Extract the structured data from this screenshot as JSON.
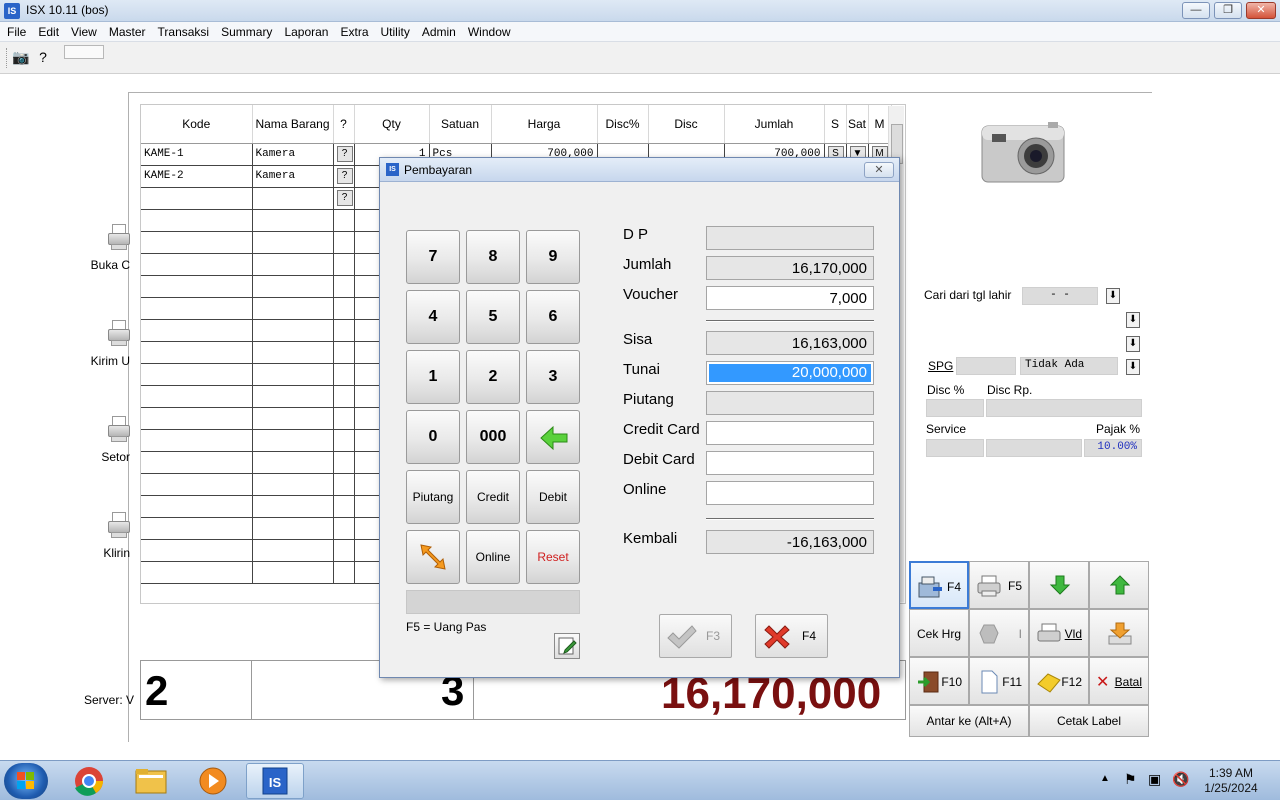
{
  "window": {
    "title": "ISX 10.11 (bos)",
    "icon": "IS"
  },
  "menu": [
    "File",
    "Edit",
    "View",
    "Master",
    "Transaksi",
    "Summary",
    "Laporan",
    "Extra",
    "Utility",
    "Admin",
    "Window"
  ],
  "toolbar": {
    "icons": [
      "camera-icon",
      "help-icon"
    ]
  },
  "side_items": [
    {
      "label": "Buka C",
      "icon": "printer-icon"
    },
    {
      "label": "Kirim U",
      "icon": "printer-icon"
    },
    {
      "label": "Setor",
      "icon": "printer-icon"
    },
    {
      "label": "Klirin",
      "icon": "printer-icon"
    }
  ],
  "grid": {
    "headers": [
      "Kode",
      "Nama Barang",
      "?",
      "Qty",
      "Satuan",
      "Harga",
      "Disc%",
      "Disc",
      "Jumlah",
      "S",
      "Sat",
      "M"
    ],
    "rows": [
      {
        "kode": "KAME-1",
        "nama": "Kamera",
        "q": "?",
        "qty": "1",
        "satuan": "Pcs",
        "harga": "700,000",
        "jumlah": "700,000",
        "s": "S",
        "sat": "▼",
        "m": "M"
      },
      {
        "kode": "KAME-2",
        "nama": "Kamera",
        "q": "?"
      },
      {
        "kode": "",
        "nama": "",
        "q": "?"
      }
    ]
  },
  "summary": {
    "count": "2",
    "qty": "3",
    "total": "16,170,000",
    "server_label": "Server: V"
  },
  "right_panel": {
    "cari_label": "Cari dari tgl lahir",
    "cari_value": "-  -",
    "spg_label": "SPG",
    "spg_value": "Tidak Ada",
    "disc_pct_label": "Disc %",
    "disc_rp_label": "Disc Rp.",
    "service_label": "Service",
    "pajak_label": "Pajak %",
    "pajak_value": "10.00%"
  },
  "function_buttons": {
    "f4": "F4",
    "f5": "F5",
    "cek_hrg": "Cek Hrg",
    "i_label": "I",
    "vld": "Vld",
    "f10": "F10",
    "f11": "F11",
    "f12": "F12",
    "batal": "Batal",
    "antar": "Antar ke (Alt+A)",
    "cetak_label": "Cetak Label"
  },
  "dialog": {
    "title": "Pembayaran",
    "keypad": [
      "7",
      "8",
      "9",
      "4",
      "5",
      "6",
      "1",
      "2",
      "3",
      "0",
      "000"
    ],
    "btn_piutang": "Piutang",
    "btn_credit": "Credit",
    "btn_debit": "Debit",
    "btn_online": "Online",
    "btn_reset": "Reset",
    "hint": "F5 = Uang Pas",
    "fields": {
      "dp": {
        "label": "D P",
        "value": ""
      },
      "jumlah": {
        "label": "Jumlah",
        "value": "16,170,000"
      },
      "voucher": {
        "label": "Voucher",
        "value": "7,000"
      },
      "sisa": {
        "label": "Sisa",
        "value": "16,163,000"
      },
      "tunai": {
        "label": "Tunai",
        "value": "20,000,000"
      },
      "piutang": {
        "label": "Piutang",
        "value": ""
      },
      "credit_card": {
        "label": "Credit Card",
        "value": ""
      },
      "debit_card": {
        "label": "Debit Card",
        "value": ""
      },
      "online": {
        "label": "Online",
        "value": ""
      },
      "kembali": {
        "label": "Kembali",
        "value": "-16,163,000"
      }
    },
    "btn_ok": "F3",
    "btn_cancel": "F4"
  },
  "taskbar": {
    "apps": [
      "windows-start-icon",
      "chrome-icon",
      "file-explorer-icon",
      "media-player-icon",
      "isx-app-icon"
    ],
    "time": "1:39 AM",
    "date": "1/25/2024"
  }
}
